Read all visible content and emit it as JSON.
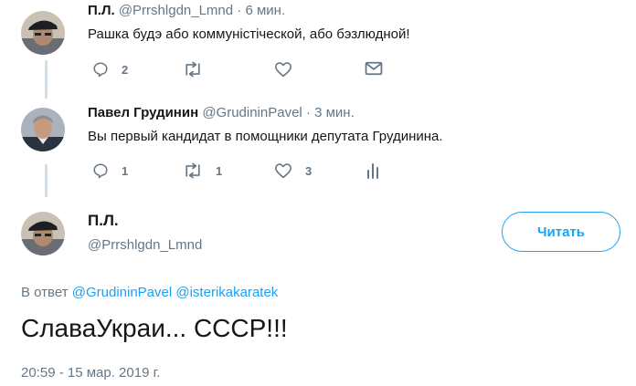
{
  "tweet1": {
    "name": "П.Л.",
    "handle": "@Prrshlgdn_Lmnd",
    "time": "6 мин.",
    "text": "Рашка будэ або коммуністіческой, або бэзлюдной!",
    "replies": "2"
  },
  "tweet2": {
    "name": "Павел Грудинин",
    "handle": "@GrudininPavel",
    "time": "3 мин.",
    "text": "Вы первый кандидат в помощники депутата Грудинина.",
    "replies": "1",
    "retweets": "1",
    "likes": "3"
  },
  "main_tweet": {
    "name": "П.Л.",
    "handle": "@Prrshlgdn_Lmnd",
    "follow_label": "Читать",
    "reply_prefix": "В ответ",
    "reply_user1": "@GrudininPavel",
    "reply_user2": "@isterikakaratek",
    "text": "СлаваУкраи... СССР!!!",
    "timestamp": "20:59 - 15 мар. 2019 г."
  },
  "separator": "·",
  "colors": {
    "accent": "#1da1f2",
    "muted": "#657786",
    "thread_line": "#cfe0eb"
  },
  "icons": [
    "reply-icon",
    "retweet-icon",
    "like-icon",
    "message-icon",
    "analytics-icon"
  ]
}
